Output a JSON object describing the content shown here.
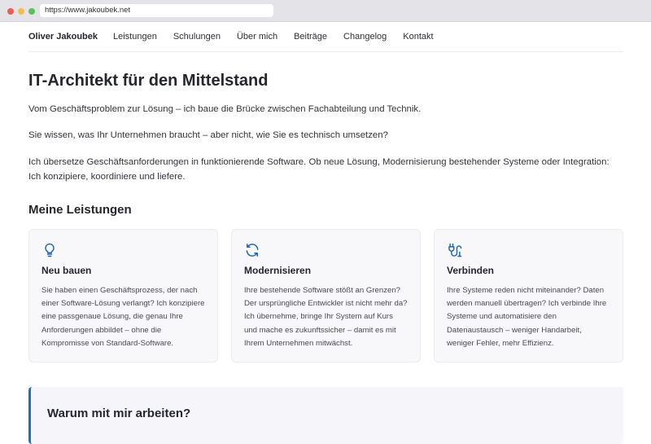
{
  "browser": {
    "url": "https://www.jakoubek.net"
  },
  "nav": {
    "brand": "Oliver Jakoubek",
    "items": [
      "Leistungen",
      "Schulungen",
      "Über mich",
      "Beiträge",
      "Changelog",
      "Kontakt"
    ]
  },
  "hero": {
    "title": "IT-Architekt für den Mittelstand",
    "p1": "Vom Geschäftsproblem zur Lösung – ich baue die Brücke zwischen Fachabteilung und Technik.",
    "p2": "Sie wissen, was Ihr Unternehmen braucht – aber nicht, wie Sie es technisch umsetzen?",
    "p3": "Ich übersetze Geschäftsanforderungen in funktionierende Software. Ob neue Lösung, Modernisierung bestehender Systeme oder Integration: Ich konzipiere, koordiniere und liefere."
  },
  "services": {
    "title": "Meine Leistungen",
    "cards": [
      {
        "icon": "lightbulb-icon",
        "title": "Neu bauen",
        "text": "Sie haben einen Geschäftsprozess, der nach einer Software-Lösung verlangt? Ich konzipiere eine passgenaue Lösung, die genau Ihre Anforderungen abbildet – ohne die Kompromisse von Standard-Software."
      },
      {
        "icon": "refresh-icon",
        "title": "Modernisieren",
        "text": "Ihre bestehende Software stößt an Grenzen? Der ursprüngliche Entwickler ist nicht mehr da? Ich übernehme, bringe Ihr System auf Kurs und mache es zukunftssicher – damit es mit Ihrem Unternehmen mitwächst."
      },
      {
        "icon": "plug-icon",
        "title": "Verbinden",
        "text": "Ihre Systeme reden nicht miteinander? Daten werden manuell übertragen? Ich verbinde Ihre Systeme und automatisiere den Datenaustausch – weniger Handarbeit, weniger Fehler, mehr Effizienz."
      }
    ]
  },
  "why": {
    "title": "Warum mit mir arbeiten?"
  },
  "colors": {
    "accent": "#2a6cc2",
    "icon": "#2166b5"
  }
}
